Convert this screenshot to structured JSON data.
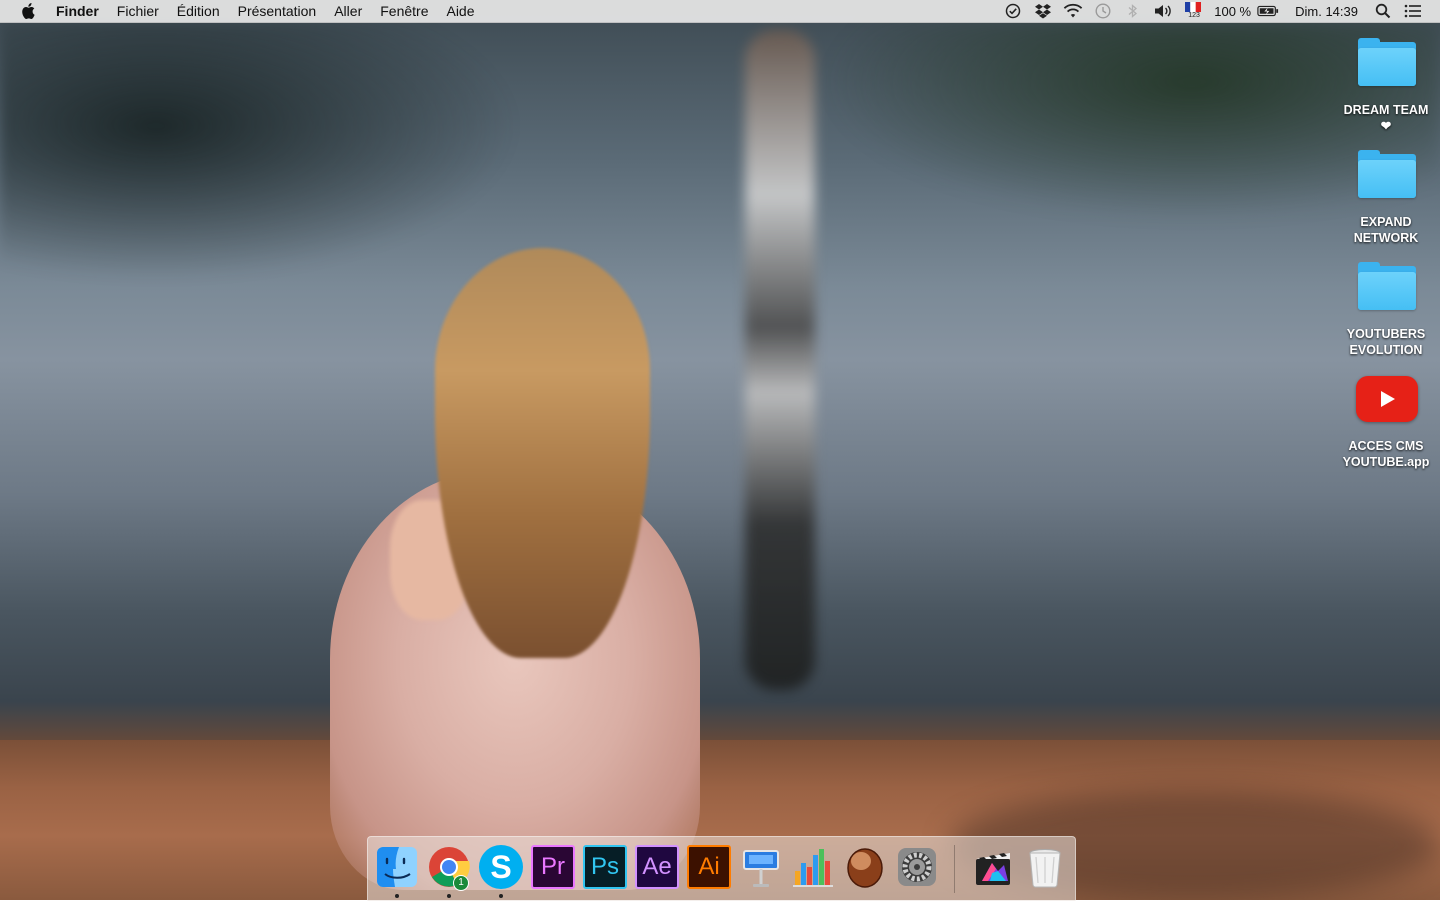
{
  "menubar": {
    "app_name": "Finder",
    "items": [
      "Fichier",
      "Édition",
      "Présentation",
      "Aller",
      "Fenêtre",
      "Aide"
    ],
    "status": {
      "battery_text": "100 %",
      "clock": "Dim. 14:39",
      "keyboard_layout_sub": "123",
      "icons": [
        "sync-check-icon",
        "dropbox-icon",
        "wifi-icon",
        "time-machine-icon",
        "bluetooth-icon",
        "volume-icon",
        "french-flag-input-icon",
        "battery-charging-icon",
        "spotlight-search-icon",
        "notification-center-icon"
      ]
    }
  },
  "desktop": {
    "icons": [
      {
        "line1": "DREAM TEAM",
        "line2": "❤",
        "kind": "folder"
      },
      {
        "line1": "EXPAND",
        "line2": "NETWORK",
        "kind": "folder"
      },
      {
        "line1": "YOUTUBERS",
        "line2": "EVOLUTION",
        "kind": "folder"
      },
      {
        "line1": "ACCES CMS",
        "line2": "YOUTUBE.app",
        "kind": "youtube-app"
      }
    ]
  },
  "dock": {
    "apps": [
      {
        "name": "Finder",
        "running": true
      },
      {
        "name": "Google Chrome",
        "running": true,
        "badge": "1"
      },
      {
        "name": "Skype",
        "running": true,
        "glyph": "S"
      },
      {
        "name": "Adobe Premiere Pro",
        "running": false,
        "glyph": "Pr"
      },
      {
        "name": "Adobe Photoshop",
        "running": false,
        "glyph": "Ps"
      },
      {
        "name": "Adobe After Effects",
        "running": false,
        "glyph": "Ae"
      },
      {
        "name": "Adobe Illustrator",
        "running": false,
        "glyph": "Ai"
      },
      {
        "name": "Keynote",
        "running": false
      },
      {
        "name": "Numbers",
        "running": false
      },
      {
        "name": "Unknown App",
        "running": false
      },
      {
        "name": "System Preferences",
        "running": false
      },
      {
        "name": "Final Cut Pro",
        "running": false
      },
      {
        "name": "Trash",
        "running": false
      }
    ]
  },
  "colors": {
    "folder": "#45bff4",
    "youtube_red": "#e62117",
    "premiere": "#ea77ff",
    "photoshop": "#31c5f0",
    "after_effects": "#d291ff",
    "illustrator": "#ff7c00"
  }
}
